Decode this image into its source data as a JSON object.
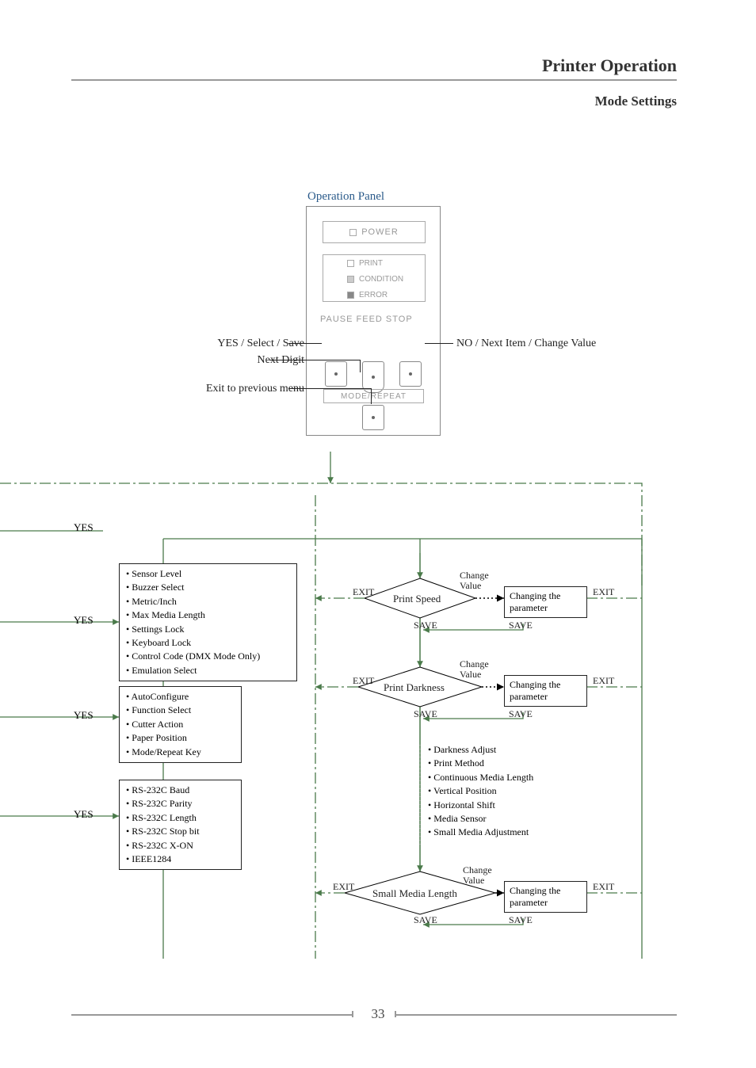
{
  "header": {
    "title": "Printer Operation",
    "subtitle": "Mode Settings"
  },
  "page_number": "33",
  "op_panel": {
    "title": "Operation Panel",
    "power": "POWER",
    "statuses": [
      "PRINT",
      "CONDITION",
      "ERROR"
    ],
    "btn_row": "PAUSE  FEED  STOP",
    "mode_repeat": "MODE/REPEAT",
    "labels": {
      "left_yes": "YES / Select / Save",
      "left_next": "Next Digit",
      "left_exit": "Exit to previous menu",
      "right_no": "NO / Next Item / Change Value"
    }
  },
  "flow": {
    "yes": "YES",
    "exit": "EXIT",
    "save": "SAVE",
    "change_value": "Change Value",
    "changing_param": "Changing the parameter",
    "decisions": {
      "print_speed": "Print Speed",
      "print_darkness": "Print Darkness",
      "small_media_length": "Small Media Length"
    },
    "list1": [
      "• Sensor Level",
      "• Buzzer Select",
      "• Metric/Inch",
      "• Max Media Length",
      "• Settings Lock",
      "• Keyboard Lock",
      "• Control Code (DMX Mode Only)",
      "• Emulation Select"
    ],
    "list2": [
      "• AutoConfigure",
      "• Function Select",
      "• Cutter Action",
      "• Paper Position",
      "• Mode/Repeat Key"
    ],
    "list3": [
      "• RS-232C Baud",
      "• RS-232C Parity",
      "• RS-232C Length",
      "• RS-232C Stop bit",
      "• RS-232C X-ON",
      "• IEEE1284"
    ],
    "list_right": [
      "• Darkness Adjust",
      "• Print Method",
      "• Continuous Media Length",
      "• Vertical Position",
      "• Horizontal Shift",
      "• Media Sensor",
      "• Small Media Adjustment"
    ]
  }
}
